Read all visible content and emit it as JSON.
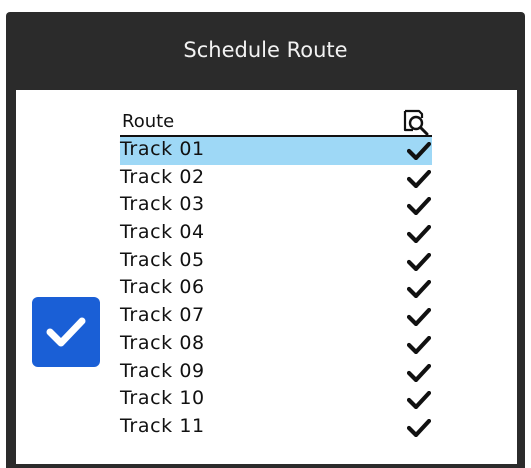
{
  "window": {
    "title": "Schedule Route"
  },
  "select_all": {
    "icon": "checkbox-checked-icon",
    "checked": true,
    "color": "#1a5fd6"
  },
  "table": {
    "column_route": "Route",
    "column_icon": "search-icon",
    "selected_row_color": "#9ed8f6",
    "rows": [
      {
        "name": "Track 01",
        "checked": true,
        "selected": true
      },
      {
        "name": "Track 02",
        "checked": true,
        "selected": false
      },
      {
        "name": "Track 03",
        "checked": true,
        "selected": false
      },
      {
        "name": "Track 04",
        "checked": true,
        "selected": false
      },
      {
        "name": "Track 05",
        "checked": true,
        "selected": false
      },
      {
        "name": "Track 06",
        "checked": true,
        "selected": false
      },
      {
        "name": "Track 07",
        "checked": true,
        "selected": false
      },
      {
        "name": "Track 08",
        "checked": true,
        "selected": false
      },
      {
        "name": "Track 09",
        "checked": true,
        "selected": false
      },
      {
        "name": "Track 10",
        "checked": true,
        "selected": false
      },
      {
        "name": "Track 11",
        "checked": true,
        "selected": false
      }
    ]
  }
}
